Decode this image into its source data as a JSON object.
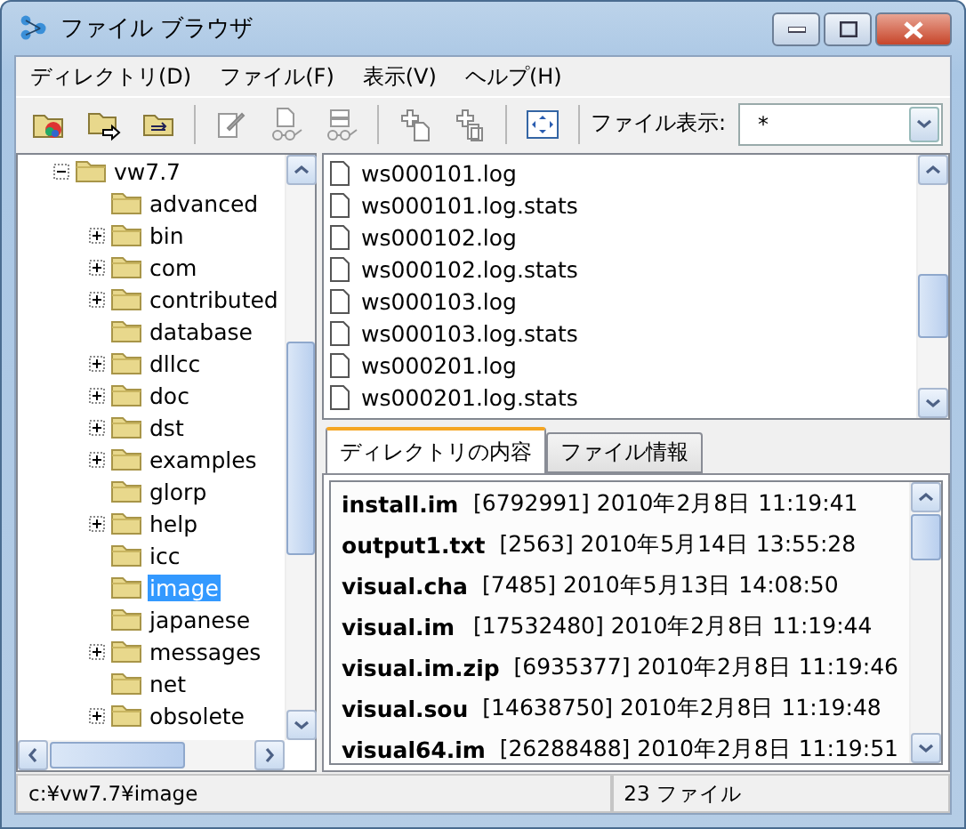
{
  "window": {
    "title": "ファイル ブラウザ"
  },
  "menu": [
    "ディレクトリ(D)",
    "ファイル(F)",
    "表示(V)",
    "ヘルプ(H)"
  ],
  "toolbar": {
    "filter_label": "ファイル表示:",
    "filter_value": "*"
  },
  "tree": [
    {
      "name": "vw7.7",
      "expanded": true,
      "selected": false,
      "children": [
        {
          "name": "advanced",
          "expandable": false,
          "selected": false
        },
        {
          "name": "bin",
          "expandable": true,
          "selected": false
        },
        {
          "name": "com",
          "expandable": true,
          "selected": false
        },
        {
          "name": "contributed",
          "expandable": true,
          "selected": false
        },
        {
          "name": "database",
          "expandable": false,
          "selected": false
        },
        {
          "name": "dllcc",
          "expandable": true,
          "selected": false
        },
        {
          "name": "doc",
          "expandable": true,
          "selected": false
        },
        {
          "name": "dst",
          "expandable": true,
          "selected": false
        },
        {
          "name": "examples",
          "expandable": true,
          "selected": false
        },
        {
          "name": "glorp",
          "expandable": false,
          "selected": false
        },
        {
          "name": "help",
          "expandable": true,
          "selected": false
        },
        {
          "name": "icc",
          "expandable": false,
          "selected": false
        },
        {
          "name": "image",
          "expandable": false,
          "selected": true
        },
        {
          "name": "japanese",
          "expandable": false,
          "selected": false
        },
        {
          "name": "messages",
          "expandable": true,
          "selected": false
        },
        {
          "name": "net",
          "expandable": false,
          "selected": false
        },
        {
          "name": "obsolete",
          "expandable": true,
          "selected": false
        }
      ]
    }
  ],
  "files": [
    "ws000101.log",
    "ws000101.log.stats",
    "ws000102.log",
    "ws000102.log.stats",
    "ws000103.log",
    "ws000103.log.stats",
    "ws000201.log",
    "ws000201.log.stats"
  ],
  "tabs": [
    {
      "label": "ディレクトリの内容",
      "selected": true
    },
    {
      "label": "ファイル情報",
      "selected": false
    }
  ],
  "details": [
    {
      "name": "install.im",
      "info": "[6792991] 2010年2月8日 11:19:41"
    },
    {
      "name": "output1.txt",
      "info": "[2563] 2010年5月14日 13:55:28"
    },
    {
      "name": "visual.cha",
      "info": "[7485] 2010年5月13日 14:08:50"
    },
    {
      "name": "visual.im",
      "info": "[17532480] 2010年2月8日 11:19:44"
    },
    {
      "name": "visual.im.zip",
      "info": "[6935377] 2010年2月8日 11:19:46"
    },
    {
      "name": "visual.sou",
      "info": "[14638750] 2010年2月8日 11:19:48"
    },
    {
      "name": "visual64.im",
      "info": "[26288488] 2010年2月8日 11:19:51"
    }
  ],
  "status_bar": {
    "path": "c:¥vw7.7¥image",
    "count": "23 ファイル"
  }
}
